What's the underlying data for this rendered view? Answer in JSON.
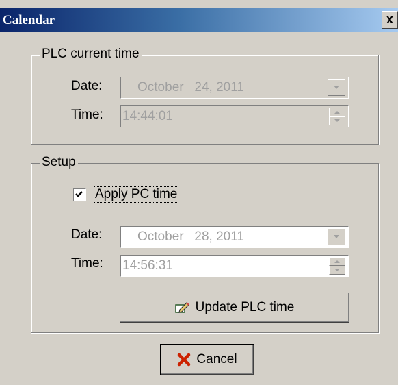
{
  "window": {
    "title": "Calendar",
    "close_glyph": "x"
  },
  "plc_current_time": {
    "legend": "PLC current time",
    "date_label": "Date:",
    "date_value": "October   24, 2011",
    "time_label": "Time:",
    "time_value": "14:44:01"
  },
  "setup": {
    "legend": "Setup",
    "apply_pc_time_label": "Apply PC time",
    "apply_pc_time_checked": true,
    "date_label": "Date:",
    "date_value": "October   28, 2011",
    "time_label": "Time:",
    "time_value": "14:56:31",
    "update_button_label": "Update PLC time",
    "update_button_icon": "pencil-edit-icon"
  },
  "footer": {
    "cancel_button_label": "Cancel",
    "cancel_button_icon": "red-x-icon"
  },
  "colors": {
    "titlebar_start": "#0a246a",
    "titlebar_end": "#a6caf0",
    "dialog_face": "#d4d0c8",
    "disabled_text": "#a0a0a0",
    "cancel_icon": "#cc2200"
  }
}
